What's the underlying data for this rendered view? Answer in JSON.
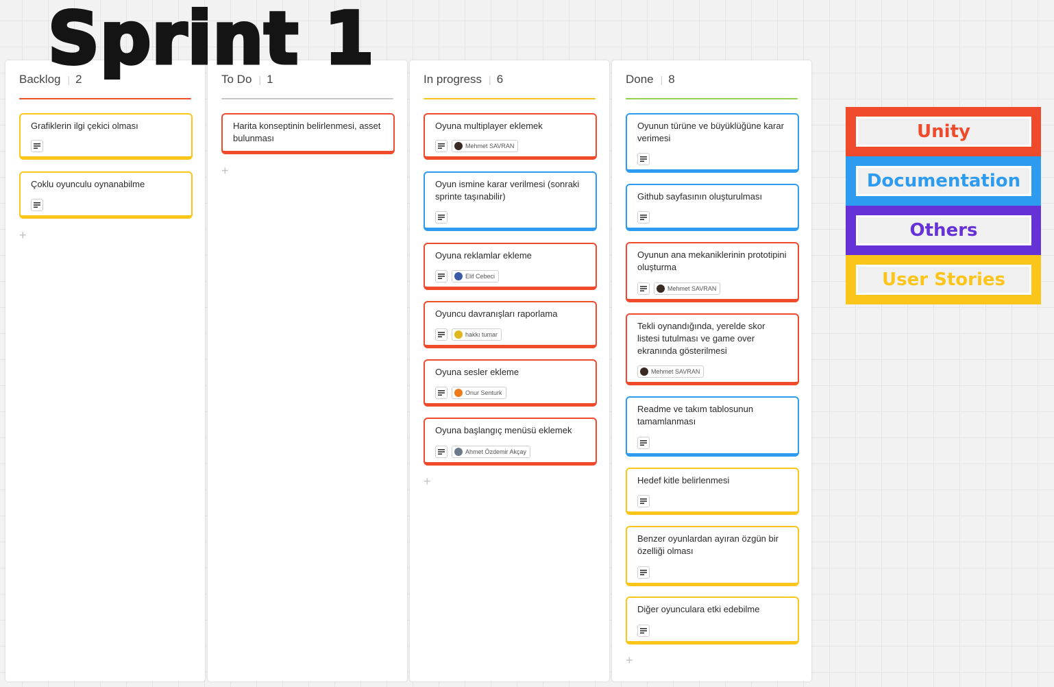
{
  "board": {
    "title": "Sprint 1"
  },
  "colors": {
    "red": "#ee4a2b",
    "blue": "#2d9bf0",
    "yellow": "#fcc51a",
    "purple": "#6631d7",
    "gray": "#c8c8c8"
  },
  "columns": [
    {
      "title": "Backlog",
      "count": "2",
      "line_color": "#ee4a2b",
      "cards": [
        {
          "text": "Grafiklerin ilgi çekici olması",
          "color": "yellow",
          "desc_icon": "description-icon"
        },
        {
          "text": "Çoklu oyunculu oynanabilme",
          "color": "yellow",
          "desc_icon": "description-icon"
        }
      ]
    },
    {
      "title": "To Do",
      "count": "1",
      "line_color": "#c8c8c8",
      "cards": [
        {
          "text": "Harita konseptinin belirlenmesi, asset bulunması",
          "color": "red"
        }
      ]
    },
    {
      "title": "In progress",
      "count": "6",
      "line_color": "#fcc51a",
      "cards": [
        {
          "text": "Oyuna multiplayer eklemek",
          "color": "red",
          "desc_icon": "description-icon",
          "assignee": "Mehmet SAVRAN",
          "avatar_color": "#3a2a22"
        },
        {
          "text": "Oyun ismine karar verilmesi (sonraki sprinte taşınabilir)",
          "color": "blue",
          "desc_icon": "description-icon"
        },
        {
          "text": "Oyuna reklamlar ekleme",
          "color": "red",
          "desc_icon": "description-icon",
          "assignee": "Elif Cebeci",
          "avatar_color": "#3b5aa8"
        },
        {
          "text": "Oyuncu davranışları raporlama",
          "color": "red",
          "desc_icon": "description-icon",
          "assignee": "hakkı tumar",
          "avatar_color": "#e0b71c"
        },
        {
          "text": "Oyuna sesler ekleme",
          "color": "red",
          "desc_icon": "description-icon",
          "assignee": "Onur Senturk",
          "avatar_color": "#ef7a1a",
          "avatar_initial": "O"
        },
        {
          "text": "Oyuna başlangıç menüsü eklemek",
          "color": "red",
          "desc_icon": "description-icon",
          "assignee": "Ahmet Özdemir Akçay",
          "avatar_color": "#6a7a8a",
          "avatar_initial": "AÖ"
        }
      ]
    },
    {
      "title": "Done",
      "count": "8",
      "line_color": "#8fd14f",
      "cards": [
        {
          "text": "Oyunun türüne ve büyüklüğüne karar verimesi",
          "color": "blue",
          "desc_icon": "description-icon"
        },
        {
          "text": "Github sayfasının oluşturulması",
          "color": "blue",
          "desc_icon": "description-icon"
        },
        {
          "text": "Oyunun ana mekaniklerinin prototipini oluşturma",
          "color": "red",
          "desc_icon": "description-icon",
          "assignee": "Mehmet SAVRAN",
          "avatar_color": "#3a2a22"
        },
        {
          "text": "Tekli oynandığında, yerelde skor listesi tutulması ve game over ekranında gösterilmesi",
          "color": "red",
          "assignee": "Mehmet SAVRAN",
          "avatar_color": "#3a2a22"
        },
        {
          "text": "Readme ve takım tablosunun tamamlanması",
          "color": "blue",
          "desc_icon": "description-icon"
        },
        {
          "text": "Hedef kitle belirlenmesi",
          "color": "yellow",
          "desc_icon": "description-icon"
        },
        {
          "text": "Benzer oyunlardan ayıran özgün bir özelliği olması",
          "color": "yellow",
          "desc_icon": "description-icon"
        },
        {
          "text": "Diğer oyunculara etki edebilme",
          "color": "yellow",
          "desc_icon": "description-icon"
        }
      ]
    }
  ],
  "add_label": "+",
  "legend": [
    {
      "label": "Unity",
      "color": "#ee4a2b"
    },
    {
      "label": "Documentation",
      "color": "#2d9bf0"
    },
    {
      "label": "Others",
      "color": "#6631d7"
    },
    {
      "label": "User Stories",
      "color": "#fcc51a"
    }
  ]
}
